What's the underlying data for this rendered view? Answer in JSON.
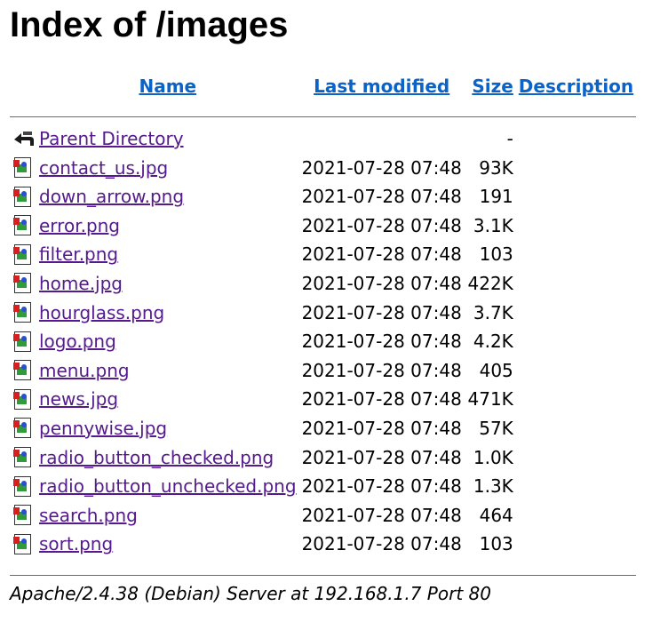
{
  "page": {
    "title": "Index of /images"
  },
  "columns": {
    "name": "Name",
    "last_modified": "Last modified",
    "size": "Size",
    "description": "Description"
  },
  "parent": {
    "label": "Parent Directory",
    "size": "-"
  },
  "files": [
    {
      "name": "contact_us.jpg",
      "modified": "2021-07-28 07:48",
      "size": "93K"
    },
    {
      "name": "down_arrow.png",
      "modified": "2021-07-28 07:48",
      "size": "191"
    },
    {
      "name": "error.png",
      "modified": "2021-07-28 07:48",
      "size": "3.1K"
    },
    {
      "name": "filter.png",
      "modified": "2021-07-28 07:48",
      "size": "103"
    },
    {
      "name": "home.jpg",
      "modified": "2021-07-28 07:48",
      "size": "422K"
    },
    {
      "name": "hourglass.png",
      "modified": "2021-07-28 07:48",
      "size": "3.7K"
    },
    {
      "name": "logo.png",
      "modified": "2021-07-28 07:48",
      "size": "4.2K"
    },
    {
      "name": "menu.png",
      "modified": "2021-07-28 07:48",
      "size": "405"
    },
    {
      "name": "news.jpg",
      "modified": "2021-07-28 07:48",
      "size": "471K"
    },
    {
      "name": "pennywise.jpg",
      "modified": "2021-07-28 07:48",
      "size": "57K"
    },
    {
      "name": "radio_button_checked.png",
      "modified": "2021-07-28 07:48",
      "size": "1.0K"
    },
    {
      "name": "radio_button_unchecked.png",
      "modified": "2021-07-28 07:48",
      "size": "1.3K"
    },
    {
      "name": "search.png",
      "modified": "2021-07-28 07:48",
      "size": "464"
    },
    {
      "name": "sort.png",
      "modified": "2021-07-28 07:48",
      "size": "103"
    }
  ],
  "footer": {
    "signature": "Apache/2.4.38 (Debian) Server at 192.168.1.7 Port 80"
  },
  "colors": {
    "link": "#551a8b",
    "header_link": "#0a63c9",
    "rule": "#6b6b6b"
  },
  "icons": {
    "parent": "back-arrow-icon",
    "file": "image-file-icon"
  }
}
